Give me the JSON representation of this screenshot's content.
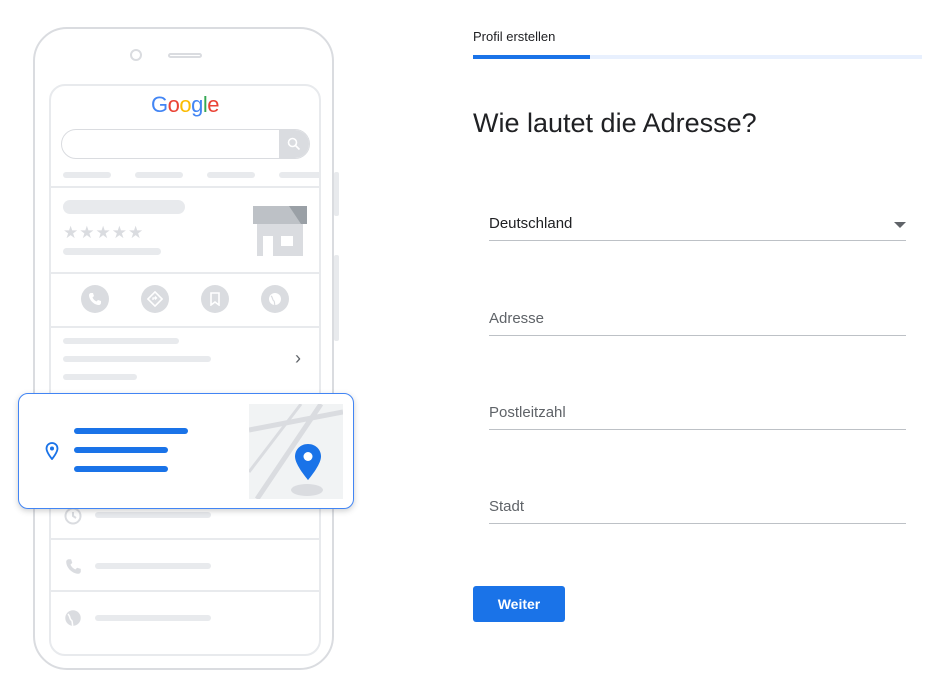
{
  "header": {
    "step_label": "Profil erstellen",
    "progress_fraction": 0.26
  },
  "main": {
    "title": "Wie lautet die Adresse?",
    "country_select": {
      "selected": "Deutschland"
    },
    "address_field": {
      "placeholder": "Adresse",
      "value": ""
    },
    "postal_code_field": {
      "placeholder": "Postleitzahl",
      "value": ""
    },
    "city_field": {
      "placeholder": "Stadt",
      "value": ""
    },
    "next_button": {
      "label": "Weiter"
    }
  },
  "illustration": {
    "logo_letters": [
      "G",
      "o",
      "o",
      "g",
      "l",
      "e"
    ],
    "logo_colors": [
      "#4285f4",
      "#ea4335",
      "#fbbc05",
      "#4285f4",
      "#34a853",
      "#ea4335"
    ],
    "star_glyphs": "★★★★★",
    "chevron_glyph": "›",
    "icons": [
      "search-icon",
      "phone-icon",
      "directions-icon",
      "bookmark-icon",
      "globe-icon",
      "clock-icon",
      "location-pin-icon",
      "map-pin-icon"
    ]
  },
  "colors": {
    "accent": "#1a73e8",
    "placeholder_grey": "#e8eaed",
    "border_grey": "#dadce0"
  }
}
